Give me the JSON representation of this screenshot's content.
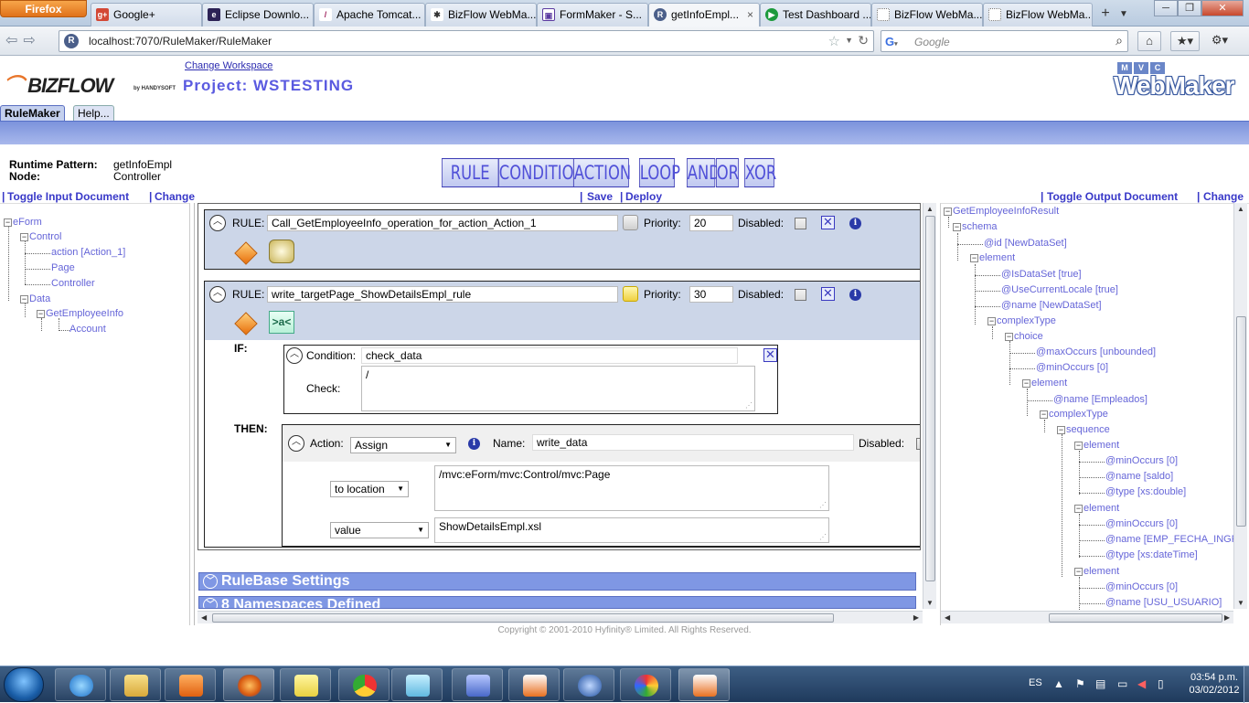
{
  "browser": {
    "menu_button": "Firefox",
    "tabs": [
      {
        "label": "Google+",
        "icon": "google-plus-icon",
        "color": "#d34836",
        "glyph": "g+"
      },
      {
        "label": "Eclipse Downlo...",
        "icon": "eclipse-icon",
        "color": "#2c2255",
        "glyph": "e"
      },
      {
        "label": "Apache Tomcat...",
        "icon": "feather-icon",
        "color": "#a0245e",
        "glyph": "/"
      },
      {
        "label": "BizFlow WebMa...",
        "icon": "gear-icon",
        "color": "#333333",
        "glyph": "✱"
      },
      {
        "label": "FormMaker - S...",
        "icon": "form-icon",
        "color": "#5a3aa0",
        "glyph": "▣"
      },
      {
        "label": "getInfoEmpl...",
        "icon": "rulemaker-icon",
        "color": "#4b5f8a",
        "glyph": "R"
      },
      {
        "label": "Test Dashboard ...",
        "icon": "play-icon",
        "color": "#1c9a3c",
        "glyph": "▶"
      },
      {
        "label": "BizFlow WebMa...",
        "icon": "blank-page-icon",
        "color": "#ffffff",
        "glyph": ""
      },
      {
        "label": "BizFlow WebMa...",
        "icon": "blank-page-icon",
        "color": "#ffffff",
        "glyph": ""
      }
    ],
    "active_tab_close": "×",
    "new_tab": "+",
    "url": "localhost:7070/RuleMaker/RuleMaker",
    "search_placeholder": "Google",
    "win_min": "─",
    "win_max": "❐",
    "win_close": "✕"
  },
  "header": {
    "logo": "BIZFLOW",
    "logo_by": "by HANDYSOFT",
    "change_workspace": "Change Workspace",
    "project": "Project: WSTESTING",
    "mvc_letters": [
      "M",
      "V",
      "C"
    ],
    "product": "WebMaker",
    "tabs": [
      "RuleMaker",
      "Help..."
    ]
  },
  "runtime": {
    "pattern_label": "Runtime Pattern:",
    "pattern_value": "getInfoEmpl",
    "node_label": "Node:",
    "node_value": "Controller"
  },
  "toolbar": {
    "buttons": [
      "RULE",
      "CONDITION",
      "ACTION",
      "LOOP",
      "AND",
      "OR",
      "XOR"
    ],
    "save": "Save",
    "deploy": "Deploy"
  },
  "left_panel": {
    "toggle": "Toggle Input Document",
    "change": "Change",
    "tree": [
      {
        "label": "eForm",
        "extra": ""
      },
      {
        "label": "Control",
        "extra": ""
      },
      {
        "label": "action",
        "extra": "[Action_1]"
      },
      {
        "label": "Page",
        "extra": ""
      },
      {
        "label": "Controller",
        "extra": ""
      },
      {
        "label": "Data",
        "extra": ""
      },
      {
        "label": "GetEmployeeInfo",
        "extra": ""
      },
      {
        "label": "Account",
        "extra": ""
      }
    ]
  },
  "rules": [
    {
      "rule_label": "RULE:",
      "name": "Call_GetEmployeeInfo_operation_for_action_Action_1",
      "priority_label": "Priority:",
      "priority": "20",
      "disabled_label": "Disabled:"
    },
    {
      "rule_label": "RULE:",
      "name": "write_targetPage_ShowDetailsEmpl_rule",
      "priority_label": "Priority:",
      "priority": "30",
      "disabled_label": "Disabled:",
      "if_label": "IF:",
      "condition_label": "Condition:",
      "condition_name": "check_data",
      "check_label": "Check:",
      "check_value": "/",
      "then_label": "THEN:",
      "action_label": "Action:",
      "action_type": "Assign",
      "action_name_label": "Name:",
      "action_name": "write_data",
      "action_disabled_label": "Disabled:",
      "location_select": "to location",
      "location_value": "/mvc:eForm/mvc:Control/mvc:Page",
      "value_select": "value",
      "value_value": "ShowDetailsEmpl.xsl",
      "xml_icon_text": ">a<"
    }
  ],
  "sections": {
    "rulebase": "RuleBase Settings",
    "namespaces": "8 Namespaces Defined"
  },
  "right_panel": {
    "toggle": "Toggle Output Document",
    "change": "Change",
    "tree": [
      {
        "label": "GetEmployeeInfoResult",
        "extra": ""
      },
      {
        "label": "schema",
        "extra": ""
      },
      {
        "label": "@id",
        "extra": "[NewDataSet]"
      },
      {
        "label": "element",
        "extra": ""
      },
      {
        "label": "@IsDataSet",
        "extra": "[true]"
      },
      {
        "label": "@UseCurrentLocale",
        "extra": "[true]"
      },
      {
        "label": "@name",
        "extra": "[NewDataSet]"
      },
      {
        "label": "complexType",
        "extra": ""
      },
      {
        "label": "choice",
        "extra": ""
      },
      {
        "label": "@maxOccurs",
        "extra": "[unbounded]"
      },
      {
        "label": "@minOccurs",
        "extra": "[0]"
      },
      {
        "label": "element",
        "extra": ""
      },
      {
        "label": "@name",
        "extra": "[Empleados]"
      },
      {
        "label": "complexType",
        "extra": ""
      },
      {
        "label": "sequence",
        "extra": ""
      },
      {
        "label": "element",
        "extra": ""
      },
      {
        "label": "@minOccurs",
        "extra": "[0]"
      },
      {
        "label": "@name",
        "extra": "[saldo]"
      },
      {
        "label": "@type",
        "extra": "[xs:double]"
      },
      {
        "label": "element",
        "extra": ""
      },
      {
        "label": "@minOccurs",
        "extra": "[0]"
      },
      {
        "label": "@name",
        "extra": "[EMP_FECHA_INGRE"
      },
      {
        "label": "@type",
        "extra": "[xs:dateTime]"
      },
      {
        "label": "element",
        "extra": ""
      },
      {
        "label": "@minOccurs",
        "extra": "[0]"
      },
      {
        "label": "@name",
        "extra": "[USU_USUARIO]"
      }
    ]
  },
  "footer": {
    "copyright": "Copyright © 2001-2010 Hyfinity® Limited. All Rights Reserved."
  },
  "taskbar": {
    "apps": [
      "internet-explorer-icon",
      "file-explorer-icon",
      "media-player-icon",
      "firefox-icon",
      "sticky-notes-icon",
      "chrome-icon",
      "notepad-icon",
      "presentation-icon",
      "java-icon",
      "quicktime-icon",
      "paint-icon",
      "java-icon"
    ],
    "language": "ES",
    "time": "03:54 p.m.",
    "date": "03/02/2012"
  }
}
